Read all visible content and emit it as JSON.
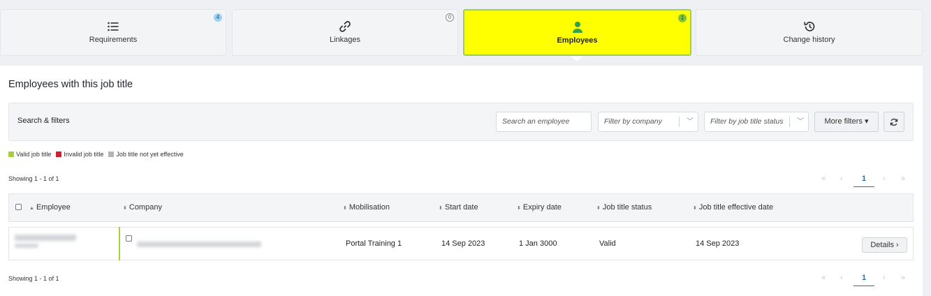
{
  "tabs": [
    {
      "label": "Requirements",
      "badge": "4"
    },
    {
      "label": "Linkages",
      "badge": "0"
    },
    {
      "label": "Employees",
      "badge": "1"
    },
    {
      "label": "Change history",
      "badge": ""
    }
  ],
  "panel": {
    "title": "Employees with this job title"
  },
  "filters": {
    "title": "Search & filters",
    "search_placeholder": "Search an employee",
    "company_placeholder": "Filter by company",
    "status_placeholder": "Filter by job title status",
    "more_label": "More filters ▾"
  },
  "legend": [
    {
      "label": "Valid job title",
      "color": "#a4d03a"
    },
    {
      "label": "Invalid job title",
      "color": "#d0202e"
    },
    {
      "label": "Job title not yet effective",
      "color": "#b5b5b5"
    }
  ],
  "pagination": {
    "showing": "Showing 1 - 1 of 1",
    "current_page": "1"
  },
  "table": {
    "headers": [
      "Employee",
      "Company",
      "Mobilisation",
      "Start date",
      "Expiry date",
      "Job title status",
      "Job title effective date"
    ],
    "row": {
      "mobilisation": "Portal Training 1",
      "start_date": "14 Sep 2023",
      "expiry_date": "1 Jan 3000",
      "status": "Valid",
      "effective_date": "14 Sep 2023",
      "details_label": "Details ›"
    }
  },
  "colors": {
    "active_tab": "#ffff00",
    "accent_green": "#a4d03a",
    "link_blue": "#1d6fb8"
  }
}
